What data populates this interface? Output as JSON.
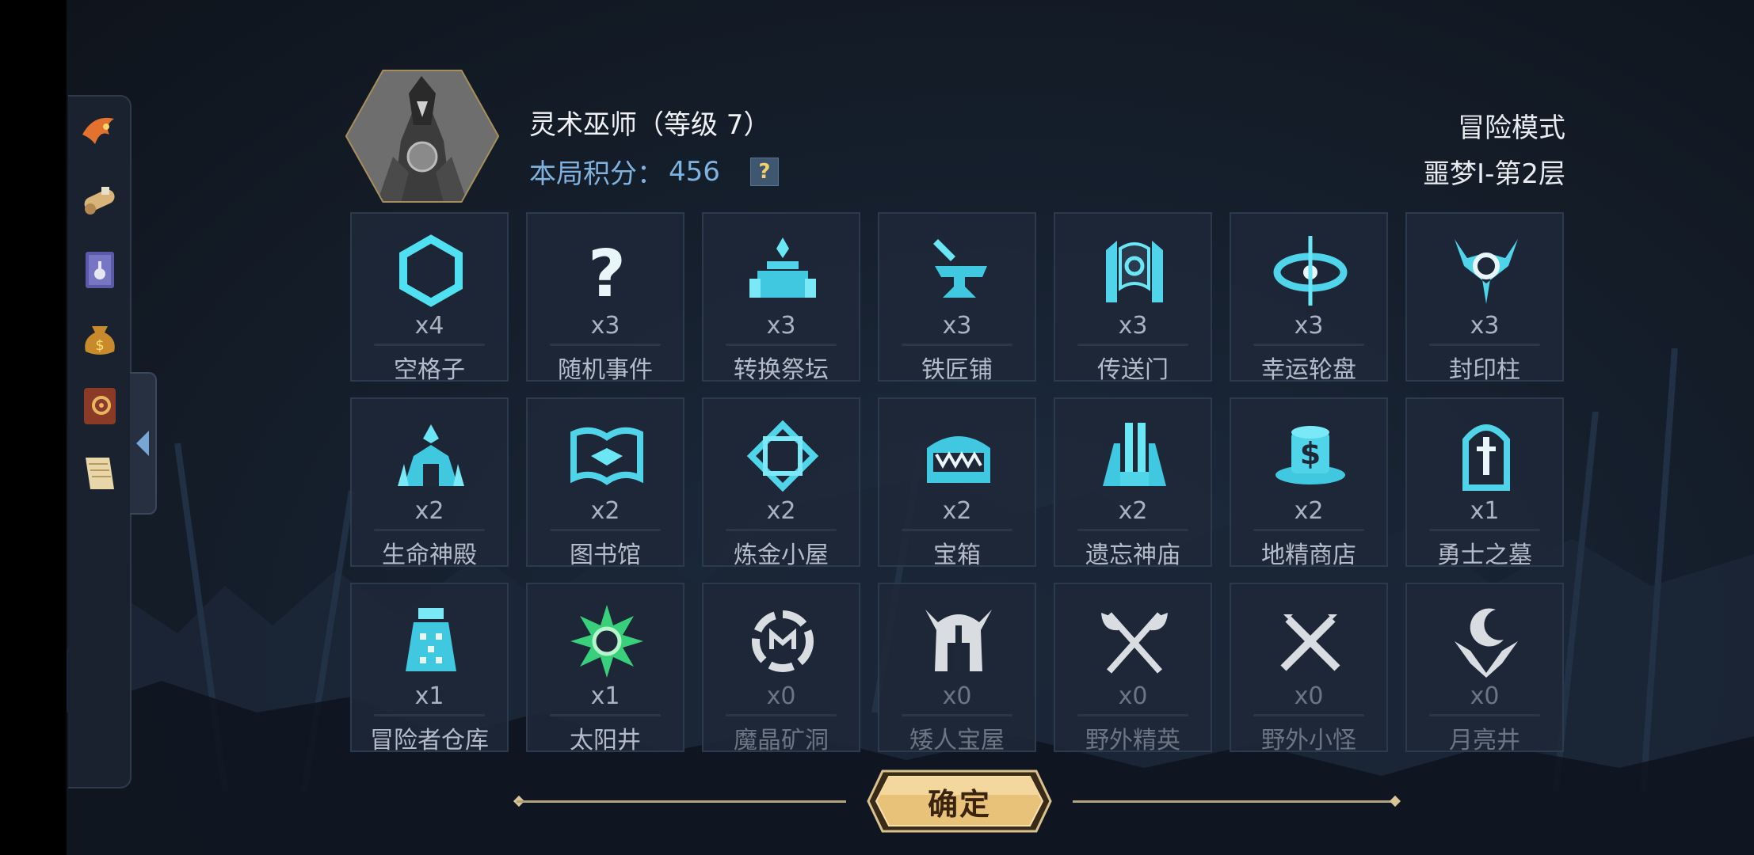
{
  "character": {
    "name": "灵术巫师（等级 7）",
    "score_label": "本局积分：",
    "score_value": "456",
    "help_label": "?"
  },
  "mode": {
    "title": "冒险模式",
    "floor": "噩梦Ⅰ-第2层"
  },
  "sidebar": {
    "items": [
      {
        "icon": "dragon-horn-icon"
      },
      {
        "icon": "scroll-icon"
      },
      {
        "icon": "potion-book-icon"
      },
      {
        "icon": "money-bag-icon"
      },
      {
        "icon": "gear-book-icon"
      },
      {
        "icon": "map-scroll-icon"
      }
    ]
  },
  "grid": {
    "rows": [
      [
        {
          "label": "空格子",
          "count": "x4",
          "icon": "hexagon-icon"
        },
        {
          "label": "随机事件",
          "count": "x3",
          "icon": "question-icon"
        },
        {
          "label": "转换祭坛",
          "count": "x3",
          "icon": "altar-icon"
        },
        {
          "label": "铁匠铺",
          "count": "x3",
          "icon": "anvil-icon"
        },
        {
          "label": "传送门",
          "count": "x3",
          "icon": "portal-icon"
        },
        {
          "label": "幸运轮盘",
          "count": "x3",
          "icon": "wheel-icon"
        },
        {
          "label": "封印柱",
          "count": "x3",
          "icon": "seal-pillar-icon"
        }
      ],
      [
        {
          "label": "生命神殿",
          "count": "x2",
          "icon": "life-temple-icon"
        },
        {
          "label": "图书馆",
          "count": "x2",
          "icon": "library-icon"
        },
        {
          "label": "炼金小屋",
          "count": "x2",
          "icon": "alchemy-icon"
        },
        {
          "label": "宝箱",
          "count": "x2",
          "icon": "chest-icon"
        },
        {
          "label": "遗忘神庙",
          "count": "x2",
          "icon": "forgotten-temple-icon"
        },
        {
          "label": "地精商店",
          "count": "x2",
          "icon": "goblin-shop-icon"
        },
        {
          "label": "勇士之墓",
          "count": "x1",
          "icon": "tomb-icon"
        }
      ],
      [
        {
          "label": "冒险者仓库",
          "count": "x1",
          "icon": "warehouse-icon"
        },
        {
          "label": "太阳井",
          "count": "x1",
          "icon": "sun-well-icon"
        },
        {
          "label": "魔晶矿洞",
          "count": "x0",
          "icon": "crystal-mine-icon"
        },
        {
          "label": "矮人宝屋",
          "count": "x0",
          "icon": "dwarf-house-icon"
        },
        {
          "label": "野外精英",
          "count": "x0",
          "icon": "elite-axes-icon"
        },
        {
          "label": "野外小怪",
          "count": "x0",
          "icon": "crossed-swords-icon"
        },
        {
          "label": "月亮井",
          "count": "x0",
          "icon": "moon-well-icon"
        }
      ]
    ]
  },
  "confirm": {
    "label": "确定"
  },
  "colors": {
    "accent": "#3fd0e6",
    "dim": "#9aa3ad",
    "green": "#38d07a",
    "gold": "#e9c27a"
  }
}
